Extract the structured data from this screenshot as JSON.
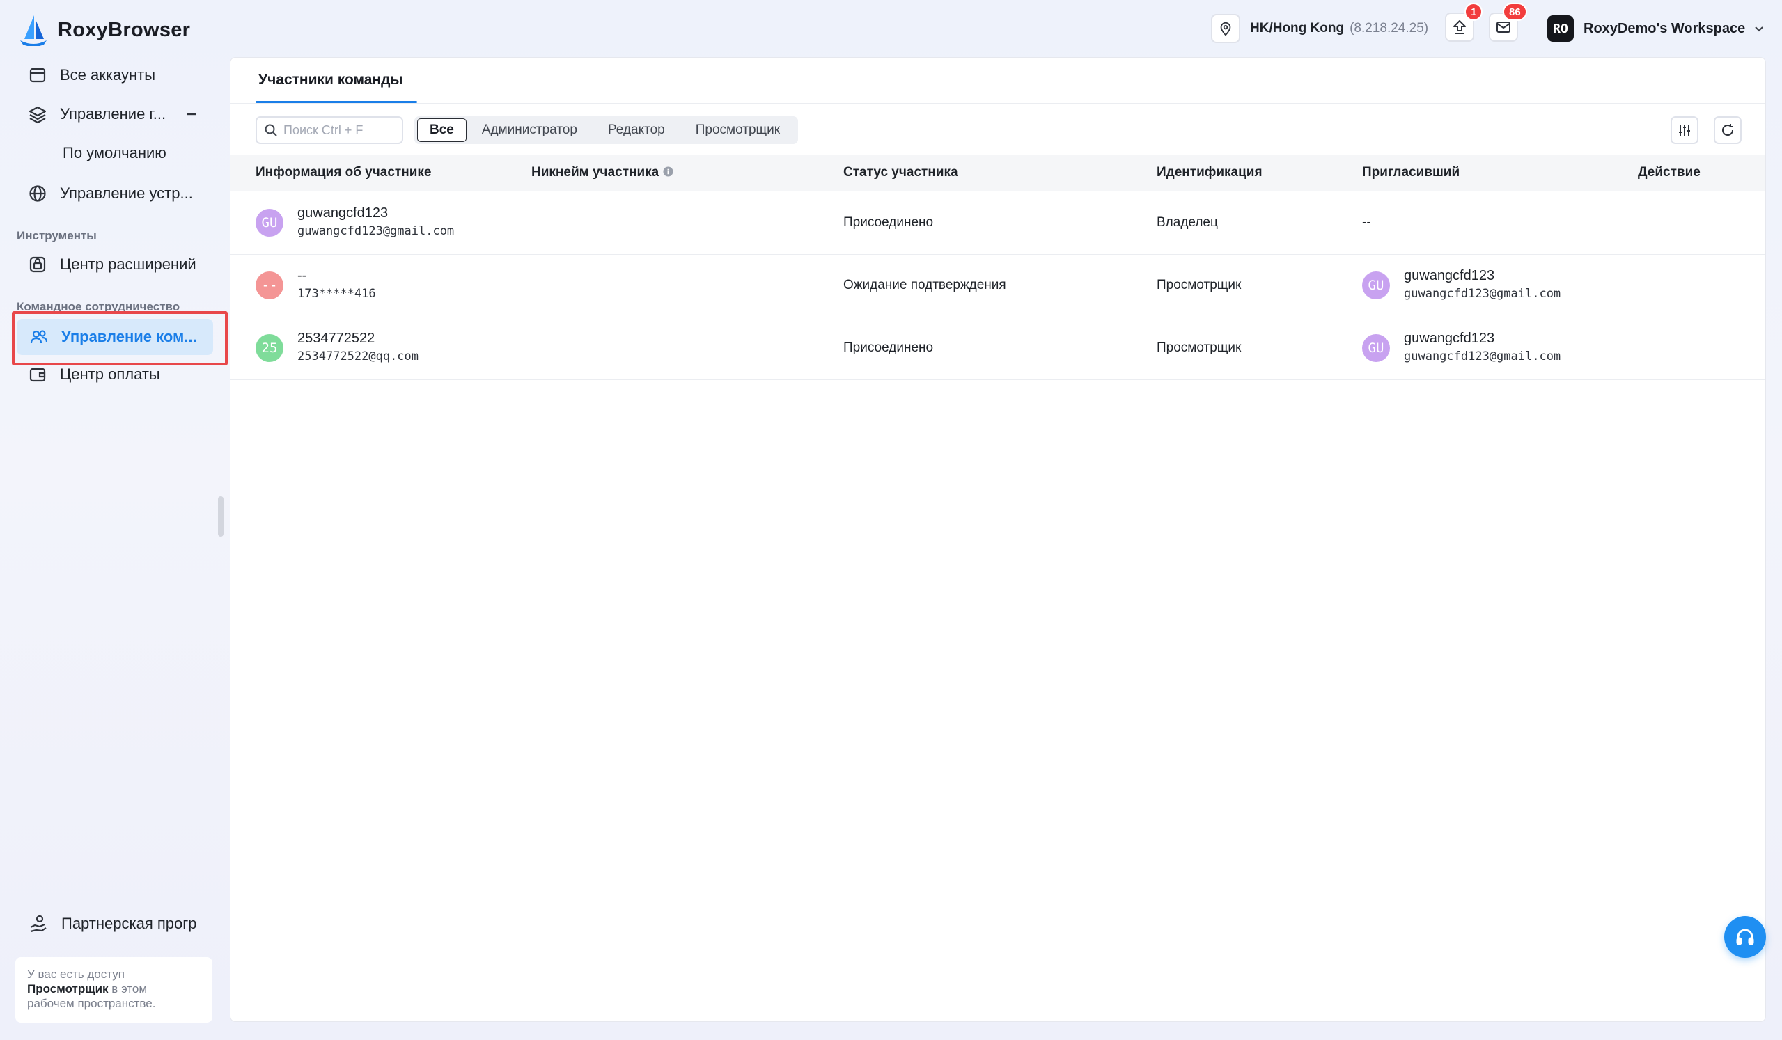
{
  "app": {
    "title": "RoxyBrowser"
  },
  "header": {
    "location": "HK/Hong Kong",
    "ip": "(8.218.24.25)",
    "upload_badge": "1",
    "mail_badge": "86",
    "workspace_initials": "RO",
    "workspace_name": "RoxyDemo's Workspace"
  },
  "sidebar": {
    "all_accounts": "Все аккаунты",
    "group_mgmt": "Управление г...",
    "default": "По умолчанию",
    "device_mgmt": "Управление устр...",
    "tools_section": "Инструменты",
    "extensions": "Центр расширений",
    "team_section": "Командное сотрудничество",
    "team_mgmt": "Управление ком...",
    "billing": "Центр оплаты",
    "partner": "Партнерская прогр",
    "access_line1": "У вас есть доступ",
    "access_role": "Просмотрщик",
    "access_line2": " в этом",
    "access_line3": "рабочем пространстве."
  },
  "main": {
    "tab": "Участники команды",
    "search_placeholder": "Поиск Ctrl + F",
    "filters": [
      "Все",
      "Администратор",
      "Редактор",
      "Просмотрщик"
    ],
    "columns": {
      "info": "Информация об участнике",
      "nickname": "Никнейм участника",
      "status": "Статус участника",
      "identity": "Идентификация",
      "inviter": "Пригласивший",
      "action": "Действие"
    },
    "rows": [
      {
        "avatar": "GU",
        "avatar_color": "#c8a2f0",
        "name": "guwangcfd123",
        "email": "guwangcfd123@gmail.com",
        "status": "Присоединено",
        "identity": "Владелец",
        "inviter_dash": "--"
      },
      {
        "avatar": "--",
        "avatar_color": "#f49595",
        "name": "--",
        "email": "173*****416",
        "status": "Ожидание подтверждения",
        "identity": "Просмотрщик",
        "inviter_avatar": "GU",
        "inviter_name": "guwangcfd123",
        "inviter_email": "guwangcfd123@gmail.com"
      },
      {
        "avatar": "25",
        "avatar_color": "#7fdc9a",
        "name": "2534772522",
        "email": "2534772522@qq.com",
        "status": "Присоединено",
        "identity": "Просмотрщик",
        "inviter_avatar": "GU",
        "inviter_name": "guwangcfd123",
        "inviter_email": "guwangcfd123@gmail.com"
      }
    ]
  },
  "colors": {
    "accent": "#1a7ee8",
    "badge": "#f23d3d",
    "active_bg": "#d7e9fb"
  }
}
